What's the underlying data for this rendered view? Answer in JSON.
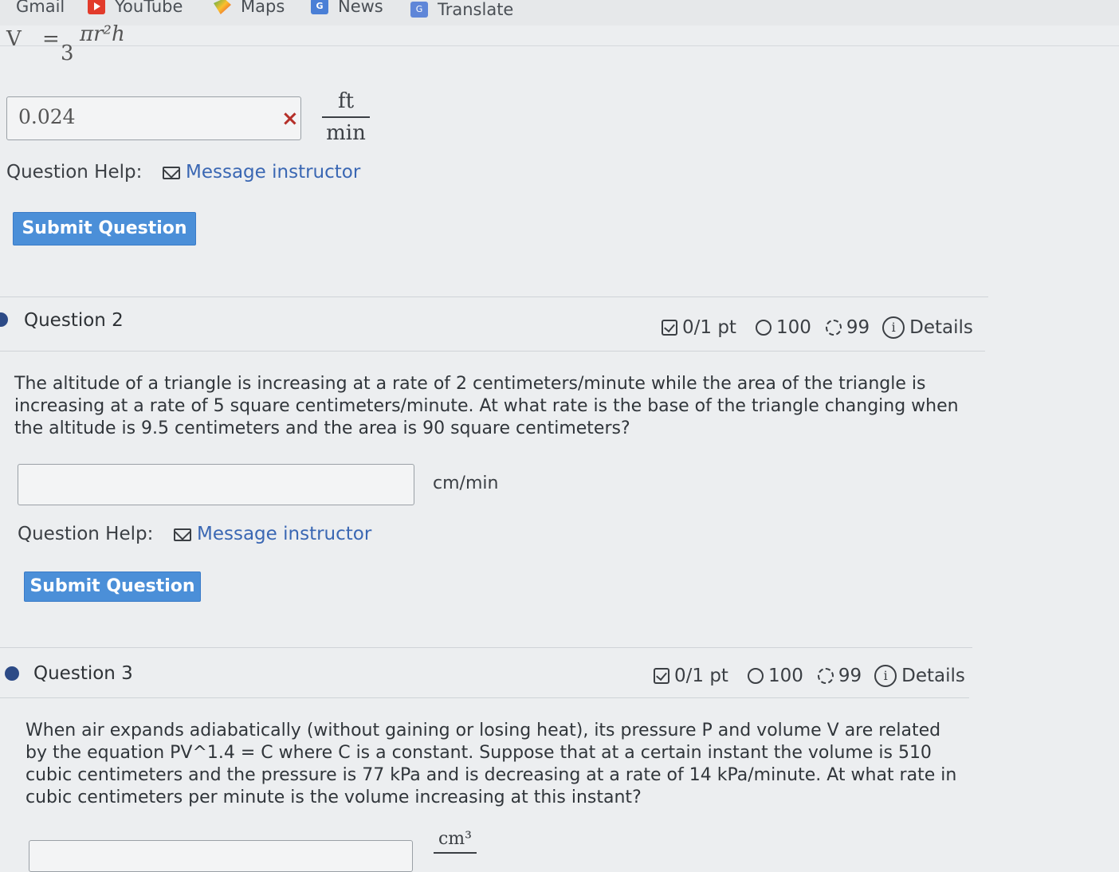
{
  "bookmarks": {
    "items": [
      "Gmail",
      "YouTube",
      "Maps",
      "News",
      "Translate"
    ]
  },
  "q1": {
    "formula_var": "V",
    "formula_eq": "=",
    "formula_frac_den": "3",
    "formula_rest": "πr²h",
    "answer_value": "0.024",
    "clear_symbol": "×",
    "unit_numerator": "ft",
    "unit_denominator": "min",
    "help_label": "Question Help:",
    "message_link": "Message instructor",
    "submit_label": "Submit Question"
  },
  "q2": {
    "title": "Question 2",
    "score": "0/1 pt",
    "attempts": "100",
    "retries": "99",
    "details": "Details",
    "text": "The altitude of a triangle is increasing at a rate of 2 centimeters/minute while the area of the triangle is increasing at a rate of 5 square centimeters/minute. At what rate is the base of the triangle changing when the altitude is 9.5 centimeters and the area is 90 square centimeters?",
    "answer_value": "",
    "unit": "cm/min",
    "help_label": "Question Help:",
    "message_link": "Message instructor",
    "submit_label": "Submit Question"
  },
  "q3": {
    "title": "Question 3",
    "score": "0/1 pt",
    "attempts": "100",
    "retries": "99",
    "details": "Details",
    "text": "When air expands adiabatically (without gaining or losing heat), its pressure P and volume V are related by the equation PV^1.4 = C where C is a constant. Suppose that at a certain instant the volume is 510 cubic centimeters and the pressure is 77 kPa and is decreasing at a rate of 14 kPa/minute. At what rate in cubic centimeters per minute is the volume increasing at this instant?",
    "unit_numerator": "cm³"
  },
  "colors": {
    "accent": "#4b8fd8",
    "link": "#3a67b3",
    "dot": "#2c4a86",
    "background": "#eceef0"
  },
  "icons": {
    "score": "checkbox-icon",
    "attempts": "undo-icon",
    "retries": "retry-icon",
    "details": "info-icon",
    "message": "mail-icon"
  }
}
